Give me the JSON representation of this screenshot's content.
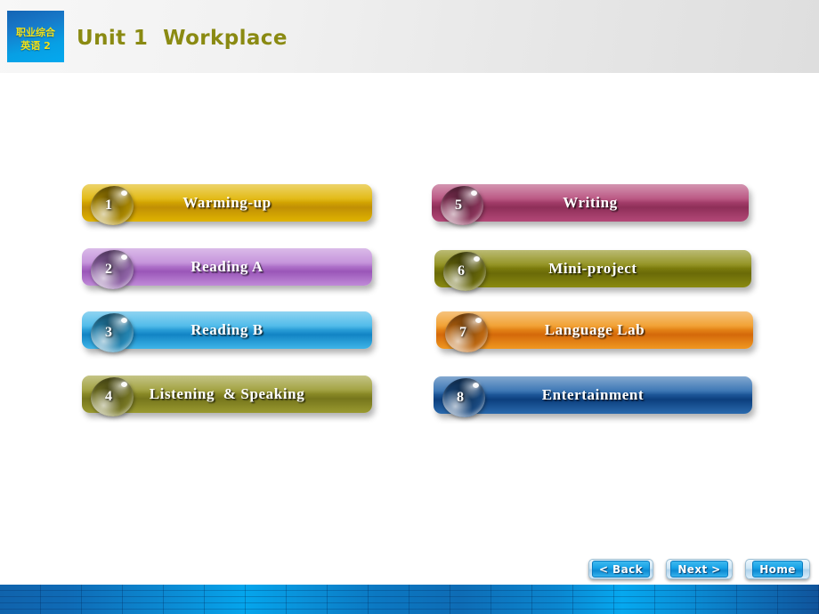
{
  "header": {
    "logo": {
      "line1": "职业综合",
      "line2": "英语 2"
    },
    "title": "Unit 1  Workplace",
    "title_color": "#8a8a12"
  },
  "menu": {
    "left_column": [
      {
        "number": "1",
        "label": "Warming-up",
        "color_from": "#e0b400",
        "color_to": "#c08f05",
        "drop_color": "#c8a000"
      },
      {
        "number": "2",
        "label": "Reading A",
        "color_from": "#c08ad8",
        "color_to": "#9a56b8",
        "drop_color": "#a874c4"
      },
      {
        "number": "3",
        "label": "Reading B",
        "color_from": "#3fb5e8",
        "color_to": "#1284c4",
        "drop_color": "#2a9ed4"
      },
      {
        "number": "4",
        "label": "Listening  & Speaking",
        "color_from": "#9a9a30",
        "color_to": "#76761c",
        "drop_color": "#8a8a28"
      }
    ],
    "right_column": [
      {
        "number": "5",
        "label": "Writing",
        "color_from": "#b44878",
        "color_to": "#8e2f58",
        "drop_color": "#a03c68"
      },
      {
        "number": "6",
        "label": "Mini-project",
        "color_from": "#8a8a10",
        "color_to": "#6a6a08",
        "drop_color": "#7a7a0c"
      },
      {
        "number": "7",
        "label": "Language Lab",
        "color_from": "#f09820",
        "color_to": "#d4690a",
        "drop_color": "#e07a12"
      },
      {
        "number": "8",
        "label": "Entertainment",
        "color_from": "#2a6aae",
        "color_to": "#0c3f7e",
        "drop_color": "#1c5596"
      }
    ]
  },
  "navigation": {
    "back_label": "< Back",
    "next_label": "Next >",
    "home_label": "Home"
  }
}
